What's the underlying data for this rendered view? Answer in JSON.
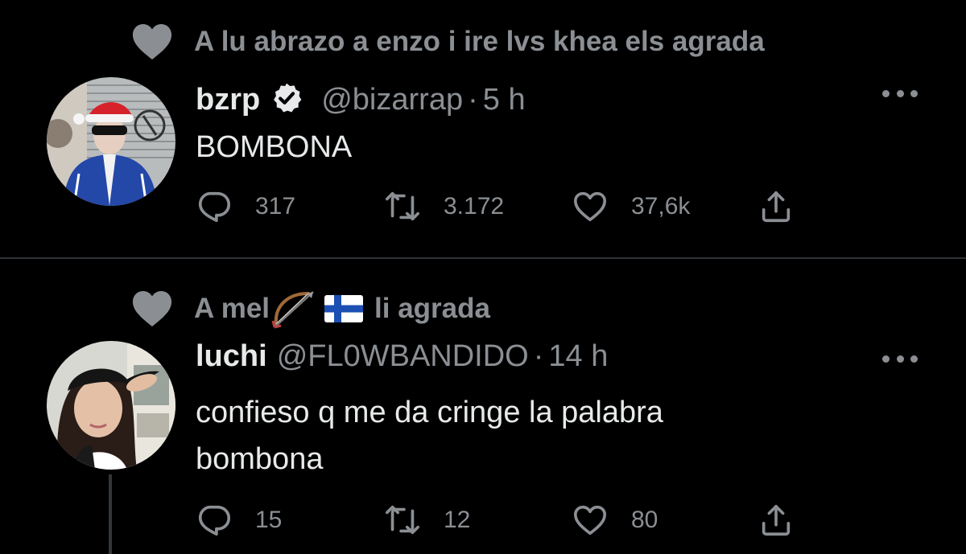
{
  "tweets": [
    {
      "social_context": "A lu abrazo a enzo i ire lvs khea els agrada",
      "display_name": "bzrp",
      "verified": true,
      "handle": "@bizarrap",
      "separator": "·",
      "time": "5 h",
      "text": "BOMBONA",
      "replies": "317",
      "retweets": "3.172",
      "likes": "37,6k"
    },
    {
      "social_context_prefix": "A mel",
      "social_context_suffix": "li agrada",
      "display_name": "luchi",
      "handle": "@FL0WBANDIDO",
      "separator": "·",
      "time": "14 h",
      "text_line1": "confieso q me da cringe la palabra",
      "text_line2": "bombona",
      "replies": "15",
      "retweets": "12",
      "likes": "80"
    }
  ],
  "icons": {
    "like": "heart-icon",
    "reply": "reply-icon",
    "retweet": "retweet-icon",
    "share": "share-icon",
    "more": "more-options-icon",
    "verified": "verified-badge-icon",
    "emoji_bow": "bow-and-arrow-emoji",
    "emoji_flag": "finland-flag-emoji"
  },
  "colors": {
    "background": "#000000",
    "primary_text": "#e7e9ea",
    "secondary_text": "#8b8f93",
    "divider": "#2f3336"
  }
}
